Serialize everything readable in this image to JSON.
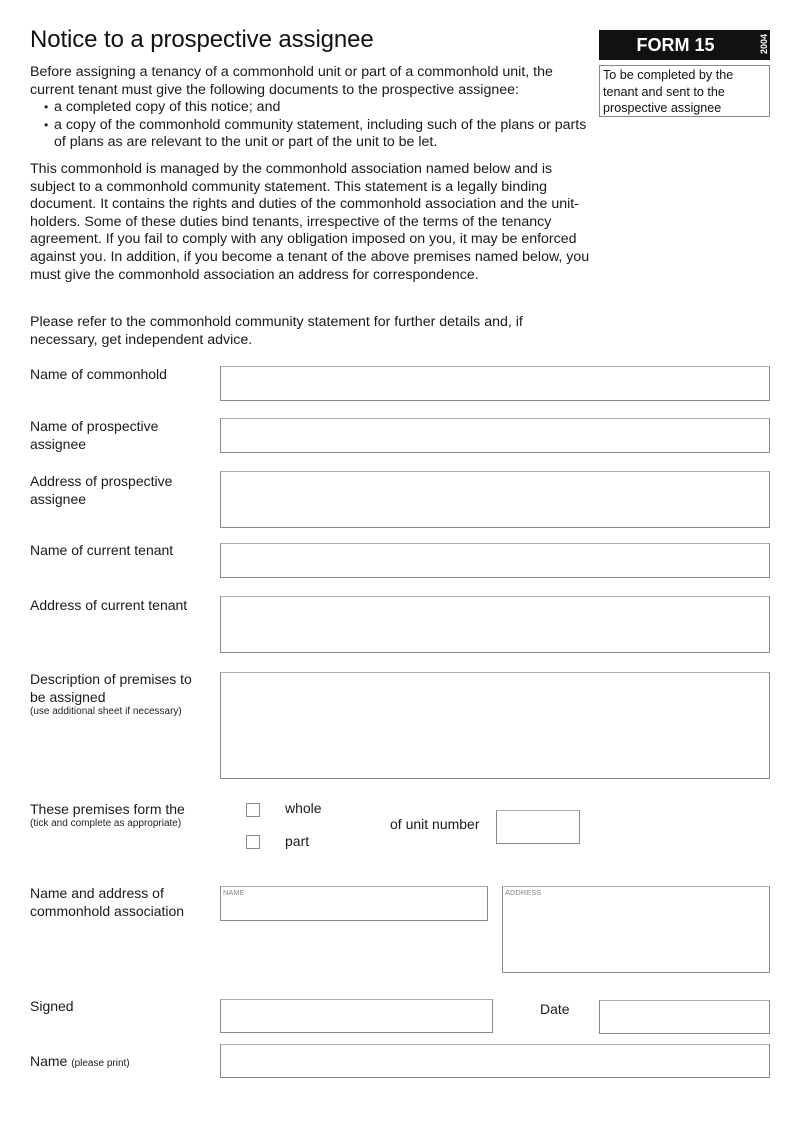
{
  "form": {
    "title": "Notice to a prospective assignee",
    "badge": "FORM 15",
    "year": "2004",
    "note": "To be completed by the tenant and sent to the prospective assignee"
  },
  "intro": {
    "paragraph1": "Before assigning a tenancy of a commonhold unit or part of a commonhold unit, the current tenant must give the following documents to the prospective assignee:",
    "bullets": [
      "a completed copy of this notice; and",
      "a copy of the commonhold community statement, including such of the plans or parts of plans as are relevant to the unit or part of the unit to be let."
    ],
    "paragraph2": "This commonhold is managed by the commonhold association named below and is subject to a commonhold community statement. This statement is a legally binding document. It contains the rights and duties of the commonhold association and the unit-holders. Some of these duties bind tenants, irrespective of the terms of the tenancy agreement. If you fail to comply with any obligation imposed on you, it may be enforced against you. In addition, if you become a tenant of the above premises named below, you must give the commonhold association an address for correspondence.",
    "paragraph3": "Please refer to the commonhold community statement for further details and, if necessary, get independent advice."
  },
  "fields": {
    "commonhold_name": {
      "label": "Name of commonhold",
      "value": ""
    },
    "assignee_name": {
      "label": "Name of prospective assignee",
      "value": ""
    },
    "assignee_address": {
      "label": "Address of prospective assignee",
      "value": ""
    },
    "tenant_name": {
      "label": "Name of current tenant",
      "value": ""
    },
    "tenant_address": {
      "label": "Address of current tenant",
      "value": ""
    },
    "premises_description": {
      "label": "Description of premises to be assigned",
      "hint": "(use additional sheet if necessary)",
      "value": ""
    },
    "premises_form": {
      "label": "These premises form the",
      "hint": "(tick and complete as appropriate)",
      "options": [
        {
          "label": "whole",
          "checked": false
        },
        {
          "label": "part",
          "checked": false
        }
      ],
      "unit_label": "of unit number",
      "unit_value": ""
    },
    "association": {
      "label": "Name and address of commonhold association",
      "name_caption": "NAME",
      "address_caption": "ADDRESS",
      "name_value": "",
      "address_value": ""
    },
    "signed": {
      "label": "Signed",
      "value": ""
    },
    "date": {
      "label": "Date",
      "value": ""
    },
    "print_name": {
      "label": "Name",
      "hint": "(please print)",
      "value": ""
    }
  }
}
